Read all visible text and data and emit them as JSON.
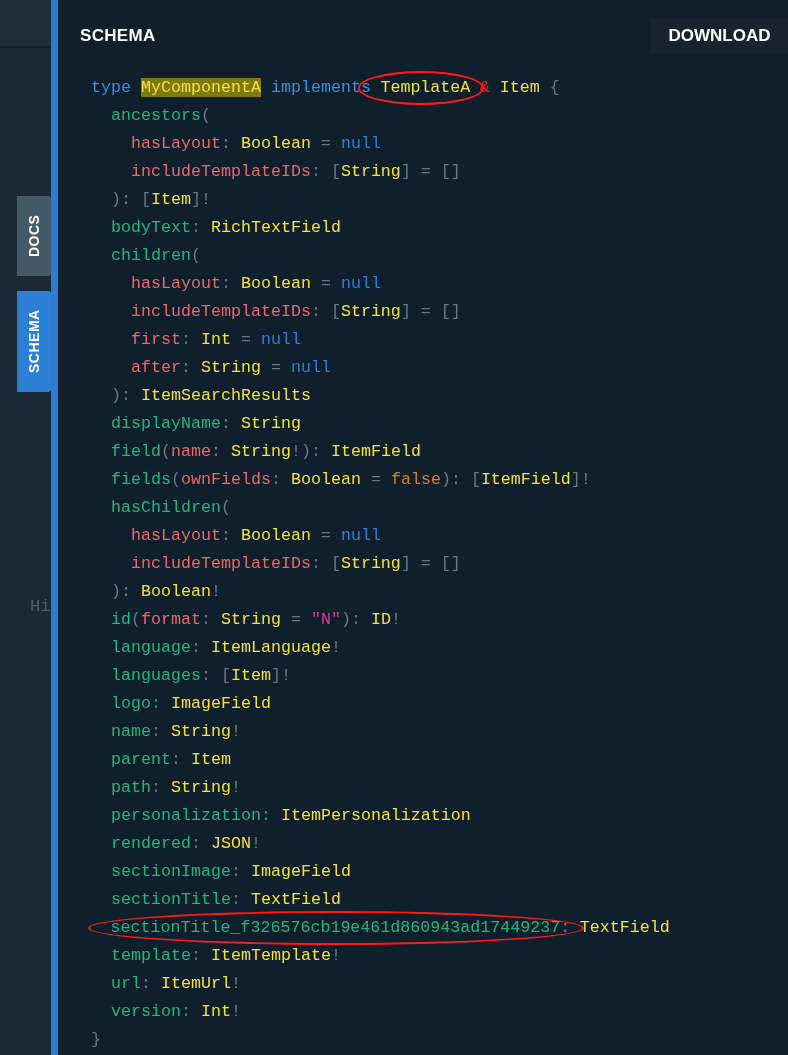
{
  "side_tabs": [
    {
      "label": "DOCS",
      "selected": false
    },
    {
      "label": "SCHEMA",
      "selected": true
    }
  ],
  "background_text": "Hi",
  "panel": {
    "title": "SCHEMA",
    "download_button": "DOWNLOAD"
  },
  "code_lines": [
    {
      "tokens": [
        {
          "text": "type ",
          "kind": "keyword"
        },
        {
          "text": "MyComponentA",
          "kind": "highlight"
        },
        {
          "text": " implements ",
          "kind": "keyword"
        },
        {
          "kind": "circled",
          "tokens": [
            {
              "text": "TemplateA",
              "kind": "type"
            }
          ]
        },
        {
          "text": " & ",
          "kind": "ampersand"
        },
        {
          "text": "Item",
          "kind": "type"
        },
        {
          "text": " {",
          "kind": "punct"
        }
      ],
      "children": [
        {
          "tokens": [
            {
              "text": "ancestors",
              "kind": "field"
            },
            {
              "text": "(",
              "kind": "punct"
            }
          ],
          "children": [
            {
              "tokens": [
                {
                  "text": "hasLayout",
                  "kind": "arg"
                },
                {
                  "text": ": ",
                  "kind": "punct"
                },
                {
                  "text": "Boolean",
                  "kind": "type"
                },
                {
                  "text": " = ",
                  "kind": "punct"
                },
                {
                  "text": "null",
                  "kind": "null"
                }
              ]
            },
            {
              "tokens": [
                {
                  "text": "includeTemplateIDs",
                  "kind": "arg"
                },
                {
                  "text": ": [",
                  "kind": "punct"
                },
                {
                  "text": "String",
                  "kind": "type"
                },
                {
                  "text": "] = []",
                  "kind": "punct"
                }
              ]
            }
          ]
        },
        {
          "tokens": [
            {
              "text": "): [",
              "kind": "punct"
            },
            {
              "text": "Item",
              "kind": "type"
            },
            {
              "text": "]!",
              "kind": "punct"
            }
          ]
        },
        {
          "tokens": [
            {
              "text": "bodyText",
              "kind": "field"
            },
            {
              "text": ": ",
              "kind": "punct"
            },
            {
              "text": "RichTextField",
              "kind": "type"
            }
          ]
        },
        {
          "tokens": [
            {
              "text": "children",
              "kind": "field"
            },
            {
              "text": "(",
              "kind": "punct"
            }
          ],
          "children": [
            {
              "tokens": [
                {
                  "text": "hasLayout",
                  "kind": "arg"
                },
                {
                  "text": ": ",
                  "kind": "punct"
                },
                {
                  "text": "Boolean",
                  "kind": "type"
                },
                {
                  "text": " = ",
                  "kind": "punct"
                },
                {
                  "text": "null",
                  "kind": "null"
                }
              ]
            },
            {
              "tokens": [
                {
                  "text": "includeTemplateIDs",
                  "kind": "arg"
                },
                {
                  "text": ": [",
                  "kind": "punct"
                },
                {
                  "text": "String",
                  "kind": "type"
                },
                {
                  "text": "] = []",
                  "kind": "punct"
                }
              ]
            },
            {
              "tokens": [
                {
                  "text": "first",
                  "kind": "arg"
                },
                {
                  "text": ": ",
                  "kind": "punct"
                },
                {
                  "text": "Int",
                  "kind": "type"
                },
                {
                  "text": " = ",
                  "kind": "punct"
                },
                {
                  "text": "null",
                  "kind": "null"
                }
              ]
            },
            {
              "tokens": [
                {
                  "text": "after",
                  "kind": "arg"
                },
                {
                  "text": ": ",
                  "kind": "punct"
                },
                {
                  "text": "String",
                  "kind": "type"
                },
                {
                  "text": " = ",
                  "kind": "punct"
                },
                {
                  "text": "null",
                  "kind": "null"
                }
              ]
            }
          ]
        },
        {
          "tokens": [
            {
              "text": "): ",
              "kind": "punct"
            },
            {
              "text": "ItemSearchResults",
              "kind": "type"
            }
          ]
        },
        {
          "tokens": [
            {
              "text": "displayName",
              "kind": "field"
            },
            {
              "text": ": ",
              "kind": "punct"
            },
            {
              "text": "String",
              "kind": "type"
            }
          ]
        },
        {
          "tokens": [
            {
              "text": "field",
              "kind": "field"
            },
            {
              "text": "(",
              "kind": "punct"
            },
            {
              "text": "name",
              "kind": "arg"
            },
            {
              "text": ": ",
              "kind": "punct"
            },
            {
              "text": "String",
              "kind": "type"
            },
            {
              "text": "!): ",
              "kind": "punct"
            },
            {
              "text": "ItemField",
              "kind": "type"
            }
          ]
        },
        {
          "tokens": [
            {
              "text": "fields",
              "kind": "field"
            },
            {
              "text": "(",
              "kind": "punct"
            },
            {
              "text": "ownFields",
              "kind": "arg"
            },
            {
              "text": ": ",
              "kind": "punct"
            },
            {
              "text": "Boolean",
              "kind": "type"
            },
            {
              "text": " = ",
              "kind": "punct"
            },
            {
              "text": "false",
              "kind": "boolean"
            },
            {
              "text": "): [",
              "kind": "punct"
            },
            {
              "text": "ItemField",
              "kind": "type"
            },
            {
              "text": "]!",
              "kind": "punct"
            }
          ]
        },
        {
          "tokens": [
            {
              "text": "hasChildren",
              "kind": "field"
            },
            {
              "text": "(",
              "kind": "punct"
            }
          ],
          "children": [
            {
              "tokens": [
                {
                  "text": "hasLayout",
                  "kind": "arg"
                },
                {
                  "text": ": ",
                  "kind": "punct"
                },
                {
                  "text": "Boolean",
                  "kind": "type"
                },
                {
                  "text": " = ",
                  "kind": "punct"
                },
                {
                  "text": "null",
                  "kind": "null"
                }
              ]
            },
            {
              "tokens": [
                {
                  "text": "includeTemplateIDs",
                  "kind": "arg"
                },
                {
                  "text": ": [",
                  "kind": "punct"
                },
                {
                  "text": "String",
                  "kind": "type"
                },
                {
                  "text": "] = []",
                  "kind": "punct"
                }
              ]
            }
          ]
        },
        {
          "tokens": [
            {
              "text": "): ",
              "kind": "punct"
            },
            {
              "text": "Boolean",
              "kind": "type"
            },
            {
              "text": "!",
              "kind": "punct"
            }
          ]
        },
        {
          "tokens": [
            {
              "text": "id",
              "kind": "field"
            },
            {
              "text": "(",
              "kind": "punct"
            },
            {
              "text": "format",
              "kind": "arg"
            },
            {
              "text": ": ",
              "kind": "punct"
            },
            {
              "text": "String",
              "kind": "type"
            },
            {
              "text": " = ",
              "kind": "punct"
            },
            {
              "text": "\"N\"",
              "kind": "string"
            },
            {
              "text": "): ",
              "kind": "punct"
            },
            {
              "text": "ID",
              "kind": "type"
            },
            {
              "text": "!",
              "kind": "punct"
            }
          ]
        },
        {
          "tokens": [
            {
              "text": "language",
              "kind": "field"
            },
            {
              "text": ": ",
              "kind": "punct"
            },
            {
              "text": "ItemLanguage",
              "kind": "type"
            },
            {
              "text": "!",
              "kind": "punct"
            }
          ]
        },
        {
          "tokens": [
            {
              "text": "languages",
              "kind": "field"
            },
            {
              "text": ": [",
              "kind": "punct"
            },
            {
              "text": "Item",
              "kind": "type"
            },
            {
              "text": "]!",
              "kind": "punct"
            }
          ]
        },
        {
          "tokens": [
            {
              "text": "logo",
              "kind": "field"
            },
            {
              "text": ": ",
              "kind": "punct"
            },
            {
              "text": "ImageField",
              "kind": "type"
            }
          ]
        },
        {
          "tokens": [
            {
              "text": "name",
              "kind": "field"
            },
            {
              "text": ": ",
              "kind": "punct"
            },
            {
              "text": "String",
              "kind": "type"
            },
            {
              "text": "!",
              "kind": "punct"
            }
          ]
        },
        {
          "tokens": [
            {
              "text": "parent",
              "kind": "field"
            },
            {
              "text": ": ",
              "kind": "punct"
            },
            {
              "text": "Item",
              "kind": "type"
            }
          ]
        },
        {
          "tokens": [
            {
              "text": "path",
              "kind": "field"
            },
            {
              "text": ": ",
              "kind": "punct"
            },
            {
              "text": "String",
              "kind": "type"
            },
            {
              "text": "!",
              "kind": "punct"
            }
          ]
        },
        {
          "tokens": [
            {
              "text": "personalization",
              "kind": "field"
            },
            {
              "text": ": ",
              "kind": "punct"
            },
            {
              "text": "ItemPersonalization",
              "kind": "type"
            }
          ]
        },
        {
          "tokens": [
            {
              "text": "rendered",
              "kind": "field"
            },
            {
              "text": ": ",
              "kind": "punct"
            },
            {
              "text": "JSON",
              "kind": "type"
            },
            {
              "text": "!",
              "kind": "punct"
            }
          ]
        },
        {
          "tokens": [
            {
              "text": "sectionImage",
              "kind": "field"
            },
            {
              "text": ": ",
              "kind": "punct"
            },
            {
              "text": "ImageField",
              "kind": "type"
            }
          ]
        },
        {
          "tokens": [
            {
              "text": "sectionTitle",
              "kind": "field"
            },
            {
              "text": ": ",
              "kind": "punct"
            },
            {
              "text": "TextField",
              "kind": "type"
            }
          ]
        },
        {
          "tokens": [
            {
              "kind": "circled",
              "tokens": [
                {
                  "text": "sectionTitle_f326576cb19e461d860943ad17449237",
                  "kind": "field"
                },
                {
                  "text": ":",
                  "kind": "punct"
                }
              ]
            },
            {
              "text": " TextField",
              "kind": "type"
            }
          ]
        },
        {
          "tokens": [
            {
              "text": "template",
              "kind": "field"
            },
            {
              "text": ": ",
              "kind": "punct"
            },
            {
              "text": "ItemTemplate",
              "kind": "type"
            },
            {
              "text": "!",
              "kind": "punct"
            }
          ]
        },
        {
          "tokens": [
            {
              "text": "url",
              "kind": "field"
            },
            {
              "text": ": ",
              "kind": "punct"
            },
            {
              "text": "ItemUrl",
              "kind": "type"
            },
            {
              "text": "!",
              "kind": "punct"
            }
          ]
        },
        {
          "tokens": [
            {
              "text": "version",
              "kind": "field"
            },
            {
              "text": ": ",
              "kind": "punct"
            },
            {
              "text": "Int",
              "kind": "type"
            },
            {
              "text": "!",
              "kind": "punct"
            }
          ]
        }
      ]
    },
    {
      "tokens": [
        {
          "text": "}",
          "kind": "punct"
        }
      ]
    }
  ]
}
